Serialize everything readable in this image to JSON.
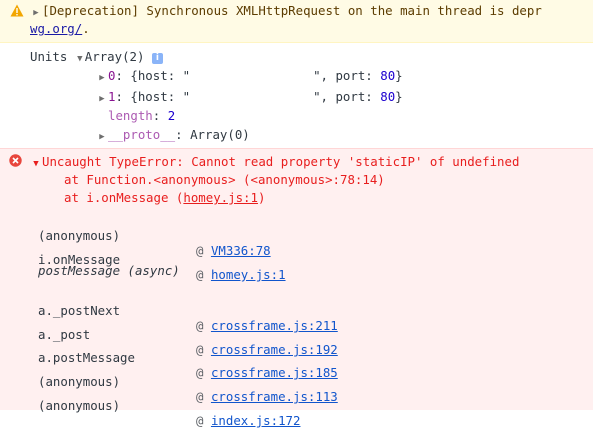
{
  "warning": {
    "icon": "warning-triangle-icon",
    "message": "[Deprecation] Synchronous XMLHttpRequest on the main thread is depr",
    "link": "wg.org/",
    "after_link": "."
  },
  "log": {
    "label": "Units",
    "array_header": "Array(2)",
    "info_badge": "i",
    "items": [
      {
        "index": "0",
        "host_open": "{host: \"",
        "host_close": "\"",
        "port_label": ", port: ",
        "port": "80",
        "close": "}"
      },
      {
        "index": "1",
        "host_open": "{host: \"",
        "host_close": "\"",
        "port_label": ", port: ",
        "port": "80",
        "close": "}"
      }
    ],
    "length_label": "length",
    "length_sep": ": ",
    "length_value": "2",
    "proto_label": "__proto__",
    "proto_sep": ": ",
    "proto_value": "Array(0)"
  },
  "error": {
    "icon": "error-circle-icon",
    "message": "Uncaught TypeError: Cannot read property 'staticIP' of undefined",
    "line2": "at Function.<anonymous> (<anonymous>:78:14)",
    "line3_prefix": "at i.onMessage (",
    "line3_link": "homey.js:1",
    "line3_suffix": ")",
    "stack": [
      {
        "fn": "(anonymous)",
        "at": "@",
        "link": "VM336:78"
      },
      {
        "fn": "i.onMessage",
        "at": "@",
        "link": "homey.js:1"
      }
    ],
    "async_label": "postMessage (async)",
    "stack2": [
      {
        "fn": "a._postNext",
        "at": "@",
        "link": "crossframe.js:211"
      },
      {
        "fn": "a._post",
        "at": "@",
        "link": "crossframe.js:192"
      },
      {
        "fn": "a.postMessage",
        "at": "@",
        "link": "crossframe.js:185"
      },
      {
        "fn": "(anonymous)",
        "at": "@",
        "link": "crossframe.js:113"
      },
      {
        "fn": "(anonymous)",
        "at": "@",
        "link": "index.js:172"
      }
    ]
  },
  "colors": {
    "warning_bg": "#fffbe5",
    "error_bg": "#fff0f0",
    "error_text": "#e81e1e",
    "link": "#1155cc"
  }
}
